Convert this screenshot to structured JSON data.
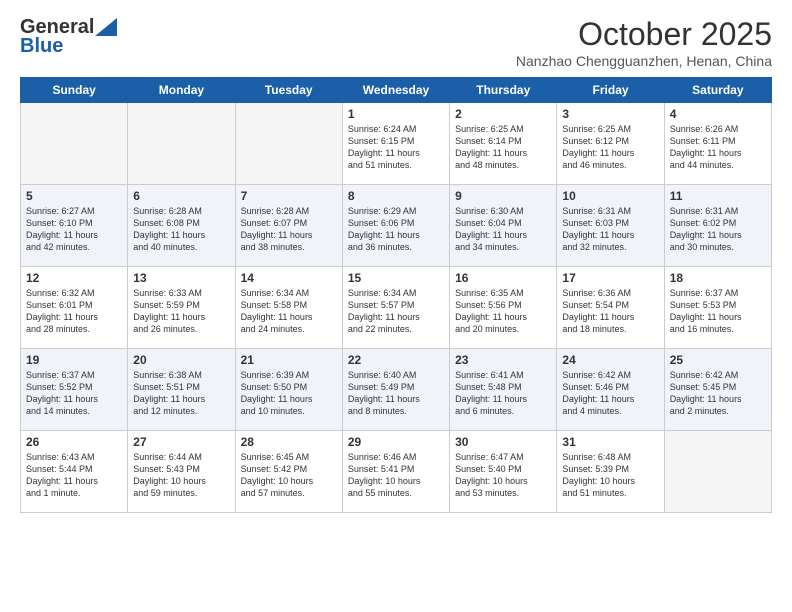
{
  "header": {
    "logo_general": "General",
    "logo_blue": "Blue",
    "month_title": "October 2025",
    "location": "Nanzhao Chengguanzhen, Henan, China"
  },
  "weekdays": [
    "Sunday",
    "Monday",
    "Tuesday",
    "Wednesday",
    "Thursday",
    "Friday",
    "Saturday"
  ],
  "weeks": [
    [
      {
        "day": "",
        "content": ""
      },
      {
        "day": "",
        "content": ""
      },
      {
        "day": "",
        "content": ""
      },
      {
        "day": "1",
        "content": "Sunrise: 6:24 AM\nSunset: 6:15 PM\nDaylight: 11 hours\nand 51 minutes."
      },
      {
        "day": "2",
        "content": "Sunrise: 6:25 AM\nSunset: 6:14 PM\nDaylight: 11 hours\nand 48 minutes."
      },
      {
        "day": "3",
        "content": "Sunrise: 6:25 AM\nSunset: 6:12 PM\nDaylight: 11 hours\nand 46 minutes."
      },
      {
        "day": "4",
        "content": "Sunrise: 6:26 AM\nSunset: 6:11 PM\nDaylight: 11 hours\nand 44 minutes."
      }
    ],
    [
      {
        "day": "5",
        "content": "Sunrise: 6:27 AM\nSunset: 6:10 PM\nDaylight: 11 hours\nand 42 minutes."
      },
      {
        "day": "6",
        "content": "Sunrise: 6:28 AM\nSunset: 6:08 PM\nDaylight: 11 hours\nand 40 minutes."
      },
      {
        "day": "7",
        "content": "Sunrise: 6:28 AM\nSunset: 6:07 PM\nDaylight: 11 hours\nand 38 minutes."
      },
      {
        "day": "8",
        "content": "Sunrise: 6:29 AM\nSunset: 6:06 PM\nDaylight: 11 hours\nand 36 minutes."
      },
      {
        "day": "9",
        "content": "Sunrise: 6:30 AM\nSunset: 6:04 PM\nDaylight: 11 hours\nand 34 minutes."
      },
      {
        "day": "10",
        "content": "Sunrise: 6:31 AM\nSunset: 6:03 PM\nDaylight: 11 hours\nand 32 minutes."
      },
      {
        "day": "11",
        "content": "Sunrise: 6:31 AM\nSunset: 6:02 PM\nDaylight: 11 hours\nand 30 minutes."
      }
    ],
    [
      {
        "day": "12",
        "content": "Sunrise: 6:32 AM\nSunset: 6:01 PM\nDaylight: 11 hours\nand 28 minutes."
      },
      {
        "day": "13",
        "content": "Sunrise: 6:33 AM\nSunset: 5:59 PM\nDaylight: 11 hours\nand 26 minutes."
      },
      {
        "day": "14",
        "content": "Sunrise: 6:34 AM\nSunset: 5:58 PM\nDaylight: 11 hours\nand 24 minutes."
      },
      {
        "day": "15",
        "content": "Sunrise: 6:34 AM\nSunset: 5:57 PM\nDaylight: 11 hours\nand 22 minutes."
      },
      {
        "day": "16",
        "content": "Sunrise: 6:35 AM\nSunset: 5:56 PM\nDaylight: 11 hours\nand 20 minutes."
      },
      {
        "day": "17",
        "content": "Sunrise: 6:36 AM\nSunset: 5:54 PM\nDaylight: 11 hours\nand 18 minutes."
      },
      {
        "day": "18",
        "content": "Sunrise: 6:37 AM\nSunset: 5:53 PM\nDaylight: 11 hours\nand 16 minutes."
      }
    ],
    [
      {
        "day": "19",
        "content": "Sunrise: 6:37 AM\nSunset: 5:52 PM\nDaylight: 11 hours\nand 14 minutes."
      },
      {
        "day": "20",
        "content": "Sunrise: 6:38 AM\nSunset: 5:51 PM\nDaylight: 11 hours\nand 12 minutes."
      },
      {
        "day": "21",
        "content": "Sunrise: 6:39 AM\nSunset: 5:50 PM\nDaylight: 11 hours\nand 10 minutes."
      },
      {
        "day": "22",
        "content": "Sunrise: 6:40 AM\nSunset: 5:49 PM\nDaylight: 11 hours\nand 8 minutes."
      },
      {
        "day": "23",
        "content": "Sunrise: 6:41 AM\nSunset: 5:48 PM\nDaylight: 11 hours\nand 6 minutes."
      },
      {
        "day": "24",
        "content": "Sunrise: 6:42 AM\nSunset: 5:46 PM\nDaylight: 11 hours\nand 4 minutes."
      },
      {
        "day": "25",
        "content": "Sunrise: 6:42 AM\nSunset: 5:45 PM\nDaylight: 11 hours\nand 2 minutes."
      }
    ],
    [
      {
        "day": "26",
        "content": "Sunrise: 6:43 AM\nSunset: 5:44 PM\nDaylight: 11 hours\nand 1 minute."
      },
      {
        "day": "27",
        "content": "Sunrise: 6:44 AM\nSunset: 5:43 PM\nDaylight: 10 hours\nand 59 minutes."
      },
      {
        "day": "28",
        "content": "Sunrise: 6:45 AM\nSunset: 5:42 PM\nDaylight: 10 hours\nand 57 minutes."
      },
      {
        "day": "29",
        "content": "Sunrise: 6:46 AM\nSunset: 5:41 PM\nDaylight: 10 hours\nand 55 minutes."
      },
      {
        "day": "30",
        "content": "Sunrise: 6:47 AM\nSunset: 5:40 PM\nDaylight: 10 hours\nand 53 minutes."
      },
      {
        "day": "31",
        "content": "Sunrise: 6:48 AM\nSunset: 5:39 PM\nDaylight: 10 hours\nand 51 minutes."
      },
      {
        "day": "",
        "content": ""
      }
    ]
  ]
}
